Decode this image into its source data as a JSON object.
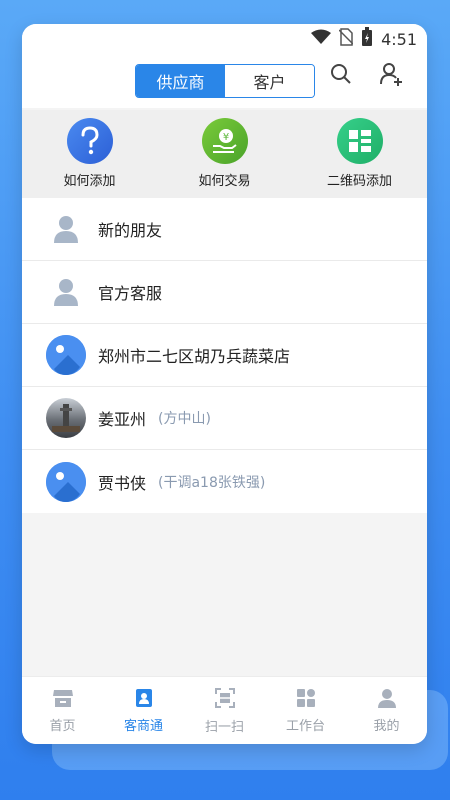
{
  "status": {
    "time": "4:51"
  },
  "segment": {
    "active": "供应商",
    "inactive": "客户"
  },
  "quick_actions": [
    {
      "label": "如何添加",
      "icon": "question-icon",
      "color": "#3a6fe0"
    },
    {
      "label": "如何交易",
      "icon": "yuan-hand-icon",
      "color": "#5cb73a"
    },
    {
      "label": "二维码添加",
      "icon": "qr-add-icon",
      "color": "#2fc57a"
    }
  ],
  "list": [
    {
      "name": "新的朋友",
      "sub": "",
      "avatar": "person-icon"
    },
    {
      "name": "官方客服",
      "sub": "",
      "avatar": "person-icon"
    },
    {
      "name": "郑州市二七区胡乃兵蔬菜店",
      "sub": "",
      "avatar": "blue-photo-avatar"
    },
    {
      "name": "姜亚州",
      "sub": "(方中山)",
      "avatar": "photo-avatar"
    },
    {
      "name": "贾书侠",
      "sub": "(干调a18张铁强)",
      "avatar": "blue-photo-avatar"
    }
  ],
  "tabs": [
    {
      "label": "首页",
      "icon": "shop-icon",
      "active": false
    },
    {
      "label": "客商通",
      "icon": "contacts-icon",
      "active": true
    },
    {
      "label": "扫一扫",
      "icon": "scan-icon",
      "active": false
    },
    {
      "label": "工作台",
      "icon": "apps-icon",
      "active": false
    },
    {
      "label": "我的",
      "icon": "user-icon",
      "active": false
    }
  ],
  "colors": {
    "accent": "#2a86e8"
  }
}
